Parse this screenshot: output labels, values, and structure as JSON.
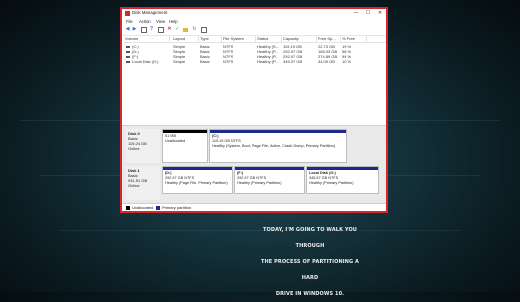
{
  "window": {
    "title": "Disk Management",
    "controls": {
      "minimize": "—",
      "maximize": "☐",
      "close": "✕"
    }
  },
  "menu": [
    "File",
    "Action",
    "View",
    "Help"
  ],
  "toolbar_icons": [
    "back-arrow-icon",
    "forward-arrow-icon",
    "grid-icon",
    "help-icon",
    "grid-icon",
    "delete-icon",
    "checkmark-icon",
    "folder-icon",
    "rescan-icon",
    "properties-icon"
  ],
  "table": {
    "headers": [
      "Volume",
      "Layout",
      "Type",
      "File System",
      "Status",
      "Capacity",
      "Free Sp...",
      "% Free"
    ],
    "rows": [
      [
        "(C:)",
        "Simple",
        "Basic",
        "NTFS",
        "Healthy (S...",
        "119.19 GB",
        "22.73 GB",
        "19 %"
      ],
      [
        "(D:)",
        "Simple",
        "Basic",
        "NTFS",
        "Healthy (P...",
        "292.97 GB",
        "165.03 GB",
        "56 %"
      ],
      [
        "(F:)",
        "Simple",
        "Basic",
        "NTFS",
        "Healthy (P...",
        "292.97 GB",
        "274.89 GB",
        "94 %"
      ],
      [
        "Local Disk (G:)",
        "Simple",
        "Basic",
        "NTFS",
        "Healthy (P...",
        "345.37 GB",
        "34.09 GB",
        "10 %"
      ]
    ]
  },
  "disks": [
    {
      "name": "Disk 0",
      "type": "Basic",
      "size": "119.24 GB",
      "status": "Online",
      "partitions": [
        {
          "title": "",
          "size": "51 MB",
          "desc": "Unallocated",
          "bar": "#000000"
        },
        {
          "title": "(C:)",
          "size": "119.19 GB NTFS",
          "desc": "Healthy (System, Boot, Page File, Active, Crash Dump, Primary Partition)",
          "bar": "#1a2b8c"
        }
      ]
    },
    {
      "name": "Disk 1",
      "type": "Basic",
      "size": "931.51 GB",
      "status": "Online",
      "partitions": [
        {
          "title": "(D:)",
          "size": "292.97 GB NTFS",
          "desc": "Healthy (Page File, Primary Partition)",
          "bar": "#1a2b8c"
        },
        {
          "title": "(F:)",
          "size": "292.97 GB NTFS",
          "desc": "Healthy (Primary Partition)",
          "bar": "#1a2b8c"
        },
        {
          "title": "Local Disk (G:)",
          "size": "345.57 GB NTFS",
          "desc": "Healthy (Primary Partition)",
          "bar": "#1a2b8c"
        }
      ]
    }
  ],
  "legend": [
    {
      "label": "Unallocated",
      "color": "#000000"
    },
    {
      "label": "Primary partition",
      "color": "#1a2b8c"
    }
  ],
  "caption": [
    "TODAY, I'M GOING TO WALK YOU THROUGH",
    "THE PROCESS OF PARTITIONING A HARD",
    "DRIVE IN WINDOWS 10."
  ]
}
